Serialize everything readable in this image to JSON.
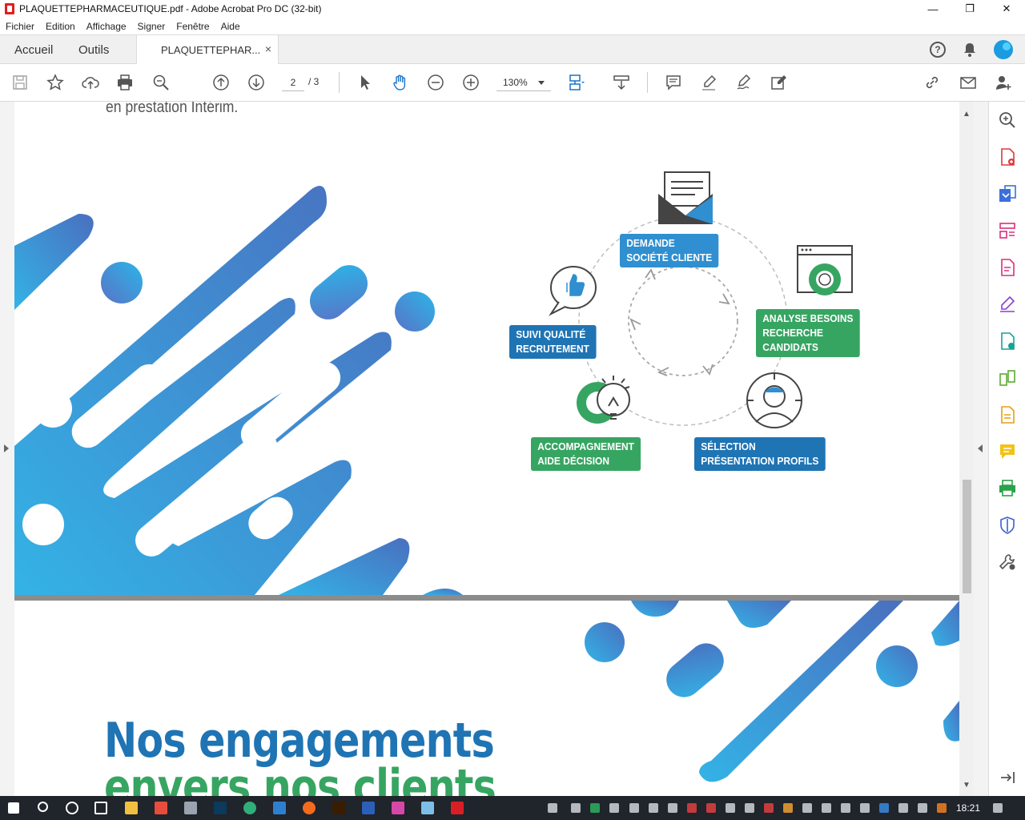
{
  "window": {
    "title": "PLAQUETTEPHARMACEUTIQUE.pdf - Adobe Acrobat Pro DC (32-bit)",
    "controls": [
      "minimize",
      "restore",
      "close"
    ]
  },
  "menu": [
    "Fichier",
    "Edition",
    "Affichage",
    "Signer",
    "Fenêtre",
    "Aide"
  ],
  "tabs": {
    "home": "Accueil",
    "tools": "Outils",
    "document": "PLAQUETTEPHAR...",
    "close": "×"
  },
  "toolbar": {
    "page_current": "2",
    "page_total": "/ 3",
    "zoom": "130%"
  },
  "document": {
    "intro_text": "en prestation Intérim.",
    "cycle_steps": [
      {
        "line1": "DEMANDE",
        "line2": "SOCIÉTÉ CLIENTE",
        "line3": "",
        "color": "#2f8fd0"
      },
      {
        "line1": "ANALYSE BESOINS",
        "line2": "RECHERCHE",
        "line3": "CANDIDATS",
        "color": "#37a562"
      },
      {
        "line1": "SÉLECTION",
        "line2": "PRÉSENTATION PROFILS",
        "line3": "",
        "color": "#1f74b4"
      },
      {
        "line1": "ACCOMPAGNEMENT",
        "line2": "AIDE DÉCISION",
        "line3": "",
        "color": "#37a562"
      },
      {
        "line1": "SUIVI QUALITÉ",
        "line2": "RECRUTEMENT",
        "line3": "",
        "color": "#1f74b4"
      }
    ],
    "heading_line1": "Nos engagements",
    "heading_line2": "envers nos clients",
    "heading_color1": "#1f74b4",
    "heading_color2": "#37a562"
  },
  "taskbar": {
    "clock": "18:21"
  }
}
